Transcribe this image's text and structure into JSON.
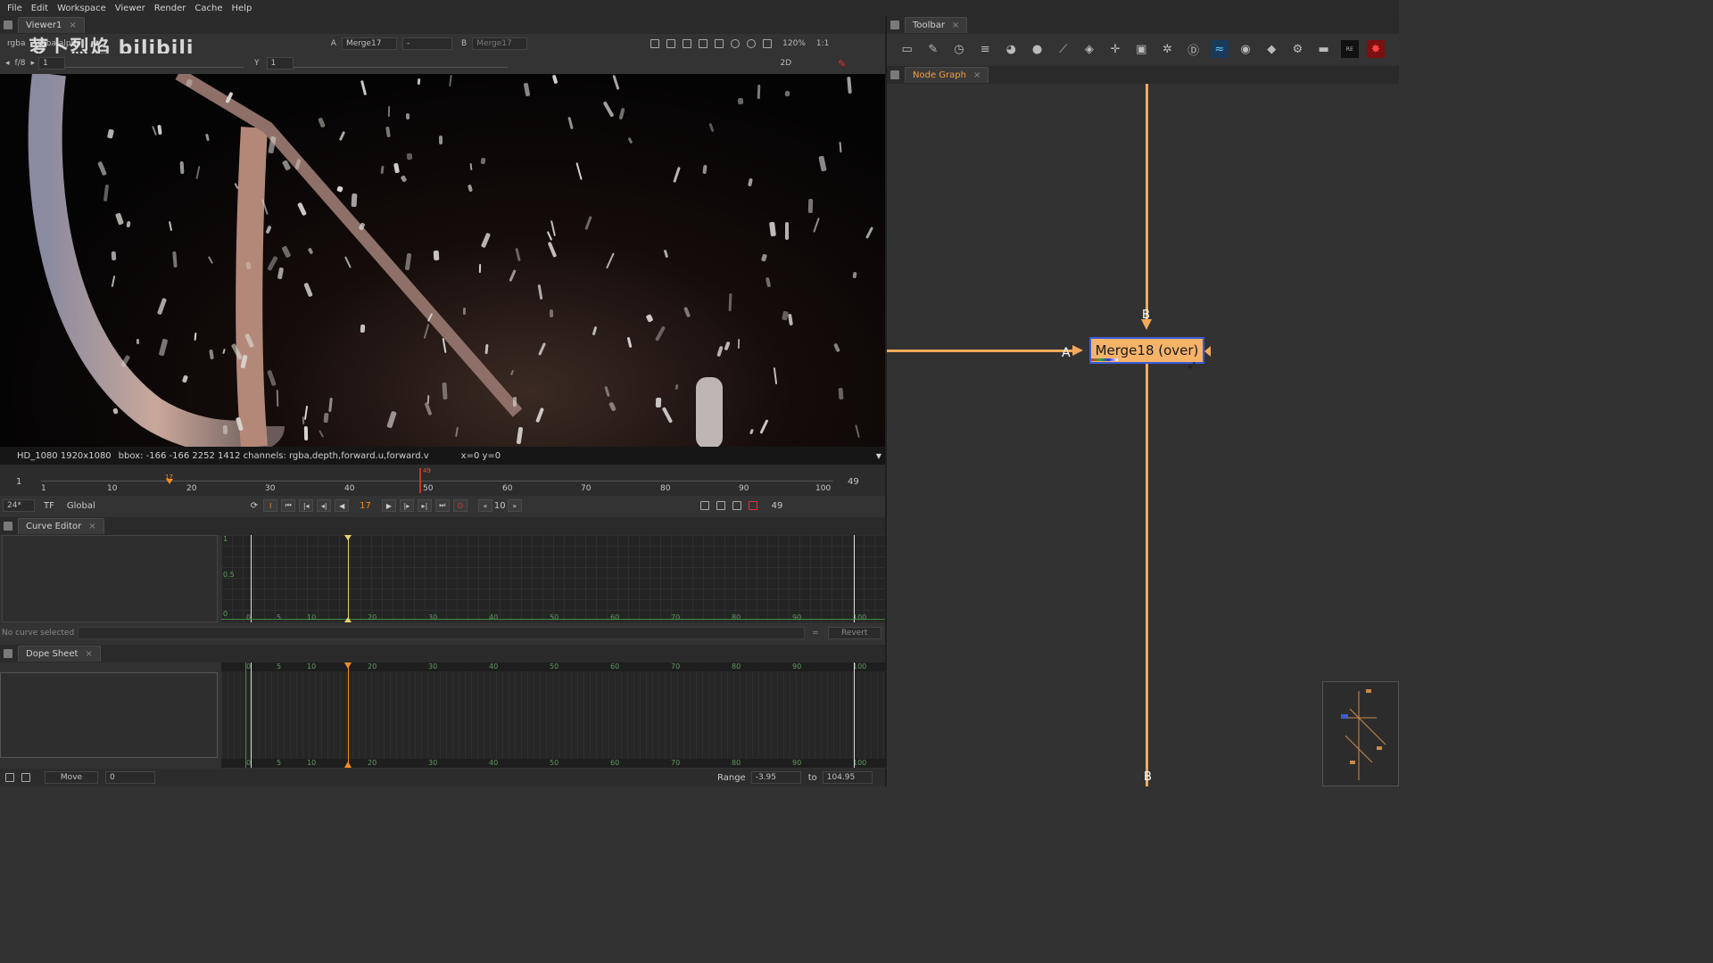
{
  "menubar": {
    "items": [
      "File",
      "Edit",
      "Workspace",
      "Viewer",
      "Render",
      "Cache",
      "Help"
    ]
  },
  "viewer": {
    "tab_label": "Viewer1",
    "channels": "rgba",
    "channel2": "rgba.alpha",
    "watermark": "萝卜烈焰 bilibili",
    "input_a_label": "A",
    "input_a_value": "Merge17",
    "wipe_value": "-",
    "input_b_label": "B",
    "input_b_value": "Merge17",
    "zoom": "120%",
    "ratio": "1:1",
    "fstop": "f/8",
    "gain_value": "1",
    "y_label": "Y",
    "gamma_value": "1",
    "view_mode": "2D",
    "info_format": "HD_1080 1920x1080",
    "info_bbox": "bbox: -166 -166 2252 1412 channels: rgba,depth,forward.u,forward.v",
    "info_coords": "x=0 y=0"
  },
  "timeline": {
    "start_frame": "1",
    "end_frame": "49",
    "ticks": [
      "1",
      "10",
      "20",
      "30",
      "40",
      "50",
      "60",
      "70",
      "80",
      "90",
      "100"
    ],
    "current_marker": "17",
    "out_marker": "49"
  },
  "transport": {
    "fps": "24*",
    "tf": "TF",
    "scope": "Global",
    "current_frame": "17",
    "step": "10",
    "end_frame": "49"
  },
  "curve_editor": {
    "tab_label": "Curve Editor",
    "y_labels": [
      "1",
      "0.5",
      "0"
    ],
    "x_labels": [
      "0",
      "5",
      "10",
      "20",
      "30",
      "40",
      "50",
      "60",
      "70",
      "80",
      "90",
      "100"
    ],
    "status": "No curve selected",
    "eq": "=",
    "revert": "Revert"
  },
  "dope_sheet": {
    "tab_label": "Dope Sheet",
    "x_labels": [
      "0",
      "5",
      "10",
      "20",
      "30",
      "40",
      "50",
      "60",
      "70",
      "80",
      "90",
      "100"
    ],
    "move_button": "Move",
    "move_value": "0",
    "range_label": "Range",
    "range_from": "-3.95",
    "range_to_label": "to",
    "range_to": "104.95"
  },
  "toolbar": {
    "tab_label": "Toolbar",
    "icons": [
      "image-icon",
      "paint-brush-icon",
      "time-icon",
      "channel-icon",
      "color-icon",
      "sphere-icon",
      "filter-icon",
      "keyer-icon",
      "merge-icon",
      "transform-icon",
      "3d-icon",
      "particles-icon",
      "deep-icon",
      "views-icon",
      "metadata-icon",
      "other-icon",
      "furnace-icon",
      "toolsets-icon",
      "reel-icon",
      "plugin-icon"
    ]
  },
  "node_graph": {
    "tab_label": "Node Graph",
    "node_label": "Merge18 (over)",
    "input_a": "A",
    "input_b_top": "B",
    "input_b_bottom": "B"
  },
  "colors": {
    "accent": "#f5a03c",
    "node_fill": "#f5b36a",
    "node_border": "#3b5bd8",
    "pipe": "#f2a95a",
    "timeline_marker": "#f08a24"
  }
}
